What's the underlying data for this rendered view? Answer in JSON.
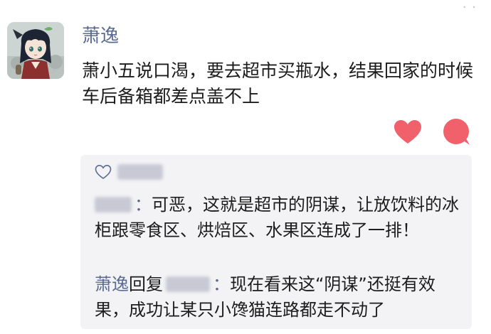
{
  "post": {
    "author_name": "萧逸",
    "text": "萧小五说口渴，要去超市买瓶水，结果回家的时候车后备箱都差点盖不上",
    "avatar_icon": "character-avatar-icon",
    "like_icon": "heart-icon",
    "comment_icon": "speech-bubble-icon",
    "more_glyph": "· ·"
  },
  "likes": {
    "icon": "heart-outline-icon"
  },
  "comments": [
    {
      "separator": "：",
      "text": "可恶，这就是超市的阴谋，让放饮料的冰柜跟零食区、烘焙区、水果区连成了一排！"
    },
    {
      "author": "萧逸",
      "reply_label": "回复",
      "separator": "：",
      "text": "现在看来这“阴谋”还挺有效果，成功让某只小馋猫连路都走不动了"
    }
  ],
  "colors": {
    "name_blue": "#5b6a92",
    "accent_pink": "#f0616c",
    "comment_bg": "#f3f3f5"
  }
}
